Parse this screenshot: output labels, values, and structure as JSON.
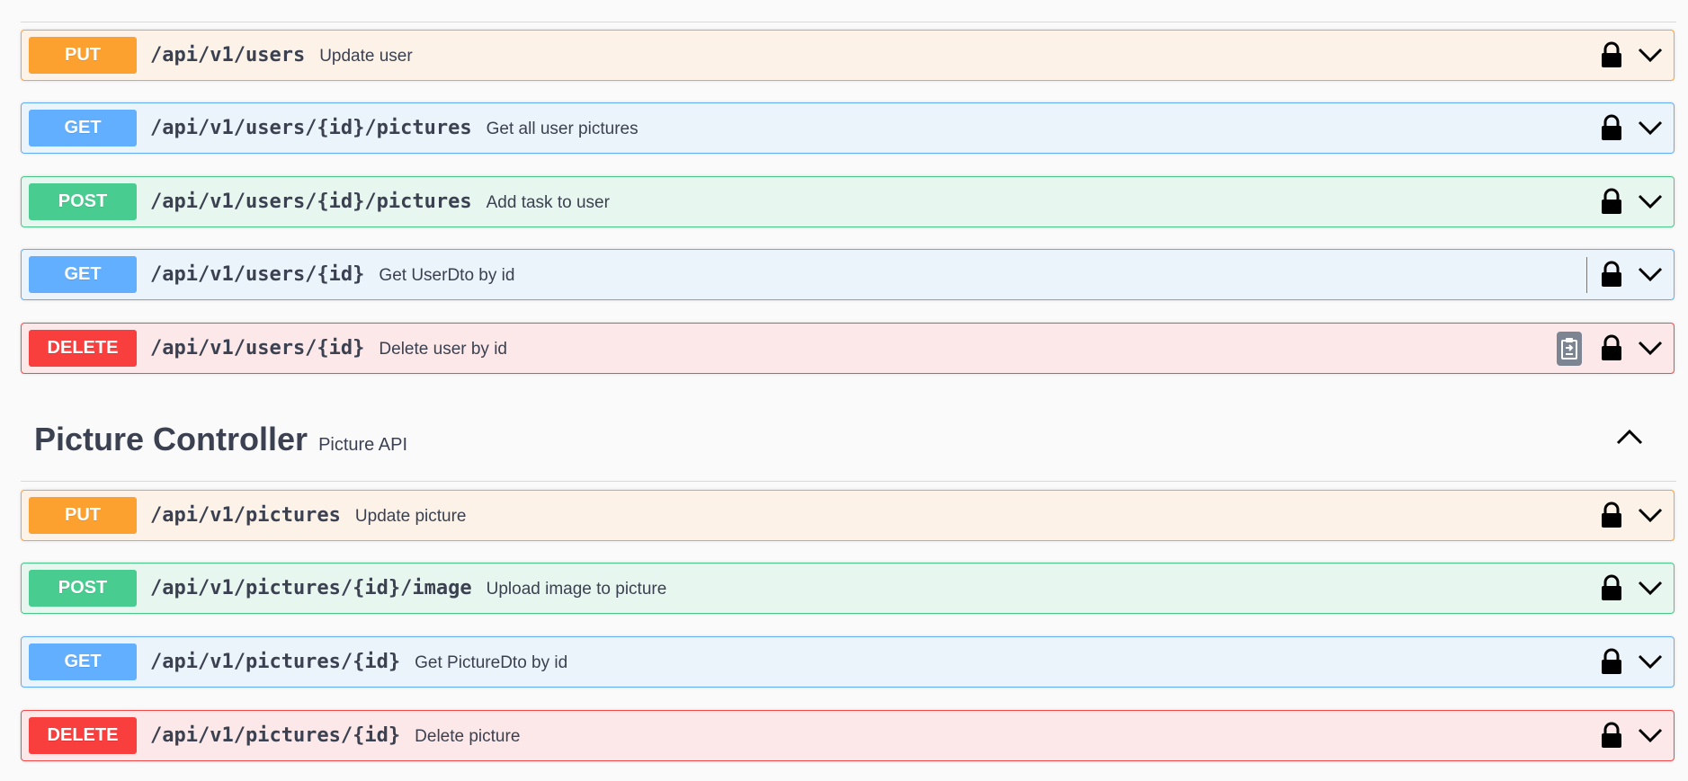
{
  "users_operations": [
    {
      "method": "PUT",
      "path": "/api/v1/users",
      "summary": "Update user"
    },
    {
      "method": "GET",
      "path": "/api/v1/users/{id}/pictures",
      "summary": "Get all user pictures"
    },
    {
      "method": "POST",
      "path": "/api/v1/users/{id}/pictures",
      "summary": "Add task to user"
    },
    {
      "method": "GET",
      "path": "/api/v1/users/{id}",
      "summary": "Get UserDto by id"
    },
    {
      "method": "DELETE",
      "path": "/api/v1/users/{id}",
      "summary": "Delete user by id"
    }
  ],
  "picture_controller": {
    "title": "Picture Controller",
    "description": "Picture API",
    "operations": [
      {
        "method": "PUT",
        "path": "/api/v1/pictures",
        "summary": "Update picture"
      },
      {
        "method": "POST",
        "path": "/api/v1/pictures/{id}/image",
        "summary": "Upload image to picture"
      },
      {
        "method": "GET",
        "path": "/api/v1/pictures/{id}",
        "summary": "Get PictureDto by id"
      },
      {
        "method": "DELETE",
        "path": "/api/v1/pictures/{id}",
        "summary": "Delete picture"
      }
    ]
  },
  "icons": {
    "lock": "lock-icon",
    "expand": "chevron-down-icon",
    "collapse": "chevron-up-icon",
    "copy": "clipboard-copy-icon"
  },
  "colors": {
    "put": "#fca130",
    "get": "#61affe",
    "post": "#49cc90",
    "delete": "#f93e3e",
    "text": "#3b4151"
  }
}
